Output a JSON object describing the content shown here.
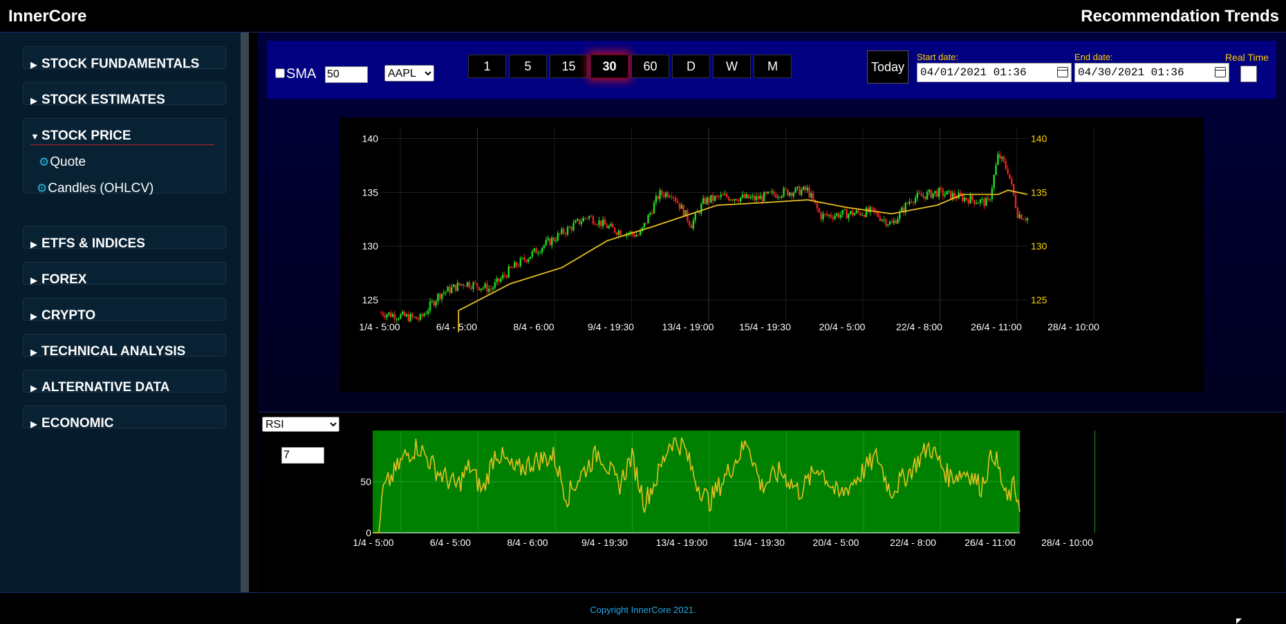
{
  "header": {
    "brand": "InnerCore",
    "title": "Recommendation Trends"
  },
  "sidebar": {
    "menus": [
      {
        "label": "STOCK FUNDAMENTALS",
        "open": false
      },
      {
        "label": "STOCK ESTIMATES",
        "open": false
      },
      {
        "label": "STOCK PRICE",
        "open": true,
        "items": [
          "Quote",
          "Candles (OHLCV)"
        ]
      },
      {
        "label": "ETFS & INDICES",
        "open": false
      },
      {
        "label": "FOREX",
        "open": false
      },
      {
        "label": "CRYPTO",
        "open": false
      },
      {
        "label": "TECHNICAL ANALYSIS",
        "open": false
      },
      {
        "label": "ALTERNATIVE DATA",
        "open": false
      },
      {
        "label": "ECONOMIC",
        "open": false
      }
    ]
  },
  "toolbar": {
    "sma_label": "SMA",
    "sma_checked": false,
    "sma_period": "50",
    "symbol": "AAPL",
    "timeframes": [
      "1",
      "5",
      "15",
      "30",
      "60",
      "D",
      "W",
      "M"
    ],
    "active_timeframe": "30",
    "today_label": "Today",
    "start_label": "Start date:",
    "start_value": "04/01/2021 01:36",
    "end_label": "End date:",
    "end_value": "04/30/2021 01:36",
    "realtime_label": "Real Time"
  },
  "chart_data": [
    {
      "type": "candlestick",
      "title": "",
      "x_tick_labels": [
        "1/4 - 5:00",
        "6/4 - 5:00",
        "8/4 - 6:00",
        "9/4 - 19:30",
        "13/4 - 19:00",
        "15/4 - 19:30",
        "20/4 - 5:00",
        "22/4 - 8:00",
        "26/4 - 11:00",
        "28/4 - 10:00"
      ],
      "y_ticks": [
        125,
        130,
        135,
        140
      ],
      "ylim": [
        123,
        141
      ],
      "grid": true,
      "colors": {
        "up": "#22dd22",
        "down": "#ee2222",
        "sma": "#e8c020",
        "left_axis": "#ffffff",
        "right_axis": "#ffd700"
      },
      "series": [
        {
          "name": "close",
          "anchors": [
            [
              0,
              123.8
            ],
            [
              0.06,
              123.2
            ],
            [
              0.09,
              125.5
            ],
            [
              0.13,
              126.6
            ],
            [
              0.17,
              126.0
            ],
            [
              0.2,
              127.8
            ],
            [
              0.25,
              130.0
            ],
            [
              0.32,
              132.8
            ],
            [
              0.36,
              131.5
            ],
            [
              0.4,
              131.0
            ],
            [
              0.43,
              134.8
            ],
            [
              0.45,
              135.0
            ],
            [
              0.48,
              132.0
            ],
            [
              0.5,
              134.2
            ],
            [
              0.53,
              134.6
            ],
            [
              0.58,
              134.4
            ],
            [
              0.62,
              135.0
            ],
            [
              0.66,
              135.2
            ],
            [
              0.68,
              132.8
            ],
            [
              0.72,
              133.0
            ],
            [
              0.76,
              133.2
            ],
            [
              0.79,
              132.0
            ],
            [
              0.82,
              134.4
            ],
            [
              0.86,
              135.0
            ],
            [
              0.9,
              134.5
            ],
            [
              0.94,
              134.0
            ],
            [
              0.955,
              138.5
            ],
            [
              0.97,
              137.0
            ],
            [
              0.985,
              133.0
            ],
            [
              1.0,
              132.6
            ]
          ]
        },
        {
          "name": "SMA",
          "anchors": [
            [
              0.12,
              122.0
            ],
            [
              0.12,
              124.0
            ],
            [
              0.2,
              126.5
            ],
            [
              0.28,
              128.0
            ],
            [
              0.35,
              130.5
            ],
            [
              0.42,
              131.8
            ],
            [
              0.48,
              133.0
            ],
            [
              0.52,
              133.8
            ],
            [
              0.58,
              134.0
            ],
            [
              0.66,
              134.3
            ],
            [
              0.72,
              133.6
            ],
            [
              0.79,
              133.0
            ],
            [
              0.86,
              133.8
            ],
            [
              0.9,
              134.8
            ],
            [
              0.955,
              134.8
            ],
            [
              0.97,
              135.2
            ],
            [
              1.0,
              134.8
            ]
          ]
        }
      ]
    },
    {
      "type": "line",
      "title": "",
      "indicator": "RSI",
      "period": "7",
      "x_tick_labels": [
        "1/4 - 5:00",
        "6/4 - 5:00",
        "8/4 - 6:00",
        "9/4 - 19:30",
        "13/4 - 19:00",
        "15/4 - 19:30",
        "20/4 - 5:00",
        "22/4 - 8:00",
        "26/4 - 11:00",
        "28/4 - 10:00"
      ],
      "y_ticks": [
        0,
        50
      ],
      "ylim": [
        0,
        100
      ],
      "colors": {
        "background": "#008000",
        "line": "#e8c020",
        "axis": "#ffffff"
      },
      "series": [
        {
          "name": "RSI",
          "anchors": [
            [
              0,
              0
            ],
            [
              0.01,
              0
            ],
            [
              0.015,
              40
            ],
            [
              0.03,
              55
            ],
            [
              0.05,
              75
            ],
            [
              0.07,
              85
            ],
            [
              0.1,
              60
            ],
            [
              0.13,
              45
            ],
            [
              0.15,
              65
            ],
            [
              0.17,
              40
            ],
            [
              0.19,
              80
            ],
            [
              0.22,
              60
            ],
            [
              0.25,
              70
            ],
            [
              0.28,
              75
            ],
            [
              0.3,
              35
            ],
            [
              0.32,
              55
            ],
            [
              0.35,
              80
            ],
            [
              0.38,
              45
            ],
            [
              0.4,
              75
            ],
            [
              0.42,
              30
            ],
            [
              0.44,
              55
            ],
            [
              0.46,
              90
            ],
            [
              0.48,
              85
            ],
            [
              0.5,
              50
            ],
            [
              0.52,
              30
            ],
            [
              0.55,
              60
            ],
            [
              0.58,
              90
            ],
            [
              0.6,
              45
            ],
            [
              0.63,
              60
            ],
            [
              0.66,
              40
            ],
            [
              0.69,
              65
            ],
            [
              0.72,
              35
            ],
            [
              0.75,
              55
            ],
            [
              0.78,
              75
            ],
            [
              0.8,
              40
            ],
            [
              0.83,
              60
            ],
            [
              0.86,
              85
            ],
            [
              0.89,
              55
            ],
            [
              0.92,
              60
            ],
            [
              0.94,
              45
            ],
            [
              0.96,
              80
            ],
            [
              0.98,
              30
            ],
            [
              0.99,
              45
            ],
            [
              1.0,
              30
            ]
          ]
        }
      ]
    }
  ],
  "footer": {
    "copyright": "Copyright InnerCore 2021."
  }
}
